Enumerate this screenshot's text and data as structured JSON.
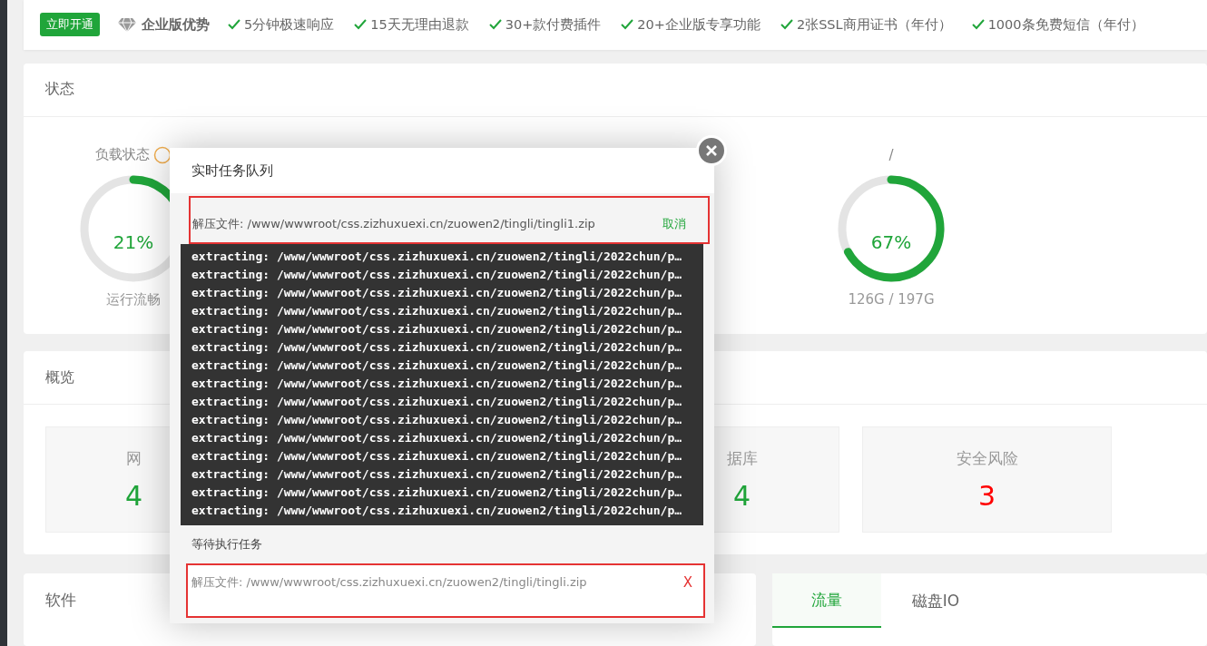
{
  "banner": {
    "button": "立即开通",
    "title": "企业版优势",
    "features": [
      "5分钟极速响应",
      "15天无理由退款",
      "30+款付费插件",
      "20+企业版专享功能",
      "2张SSL商用证书（年付）",
      "1000条免费短信（年付）"
    ]
  },
  "status": {
    "title": "状态",
    "gauges": [
      {
        "kind": "load",
        "label": "负载状态",
        "value": "21%",
        "level": 0.21,
        "caption": "运行流畅"
      },
      {
        "kind": "disk",
        "label": "/",
        "value": "67%",
        "level": 0.67,
        "caption": "126G / 197G"
      }
    ]
  },
  "overview": {
    "title": "概览",
    "cards": [
      {
        "label": "网",
        "value": "4",
        "color": "#20a53a"
      },
      {
        "label": "据库",
        "value": "4",
        "color": "#20a53a"
      },
      {
        "label": "安全风险",
        "value": "3",
        "color": "#ff0000"
      }
    ]
  },
  "software": {
    "title": "软件"
  },
  "traffic": {
    "tabs": [
      {
        "label": "流量",
        "selected": true
      },
      {
        "label": "磁盘IO",
        "selected": false
      }
    ]
  },
  "dialog": {
    "title": "实时任务队列",
    "current_task": {
      "text": "解压文件: /www/wwwroot/css.zizhuxuexi.cn/zuowen2/tingli/tingli1.zip",
      "action": "取消"
    },
    "log": [
      "extracting: /www/wwwroot/css.zizhuxuexi.cn/zuowen2/tingli/2022chun/p…",
      "extracting: /www/wwwroot/css.zizhuxuexi.cn/zuowen2/tingli/2022chun/p…",
      "extracting: /www/wwwroot/css.zizhuxuexi.cn/zuowen2/tingli/2022chun/p…",
      "extracting: /www/wwwroot/css.zizhuxuexi.cn/zuowen2/tingli/2022chun/p…",
      "extracting: /www/wwwroot/css.zizhuxuexi.cn/zuowen2/tingli/2022chun/p…",
      "extracting: /www/wwwroot/css.zizhuxuexi.cn/zuowen2/tingli/2022chun/p…",
      "extracting: /www/wwwroot/css.zizhuxuexi.cn/zuowen2/tingli/2022chun/p…",
      "extracting: /www/wwwroot/css.zizhuxuexi.cn/zuowen2/tingli/2022chun/p…",
      "extracting: /www/wwwroot/css.zizhuxuexi.cn/zuowen2/tingli/2022chun/p…",
      "extracting: /www/wwwroot/css.zizhuxuexi.cn/zuowen2/tingli/2022chun/p…",
      "extracting: /www/wwwroot/css.zizhuxuexi.cn/zuowen2/tingli/2022chun/p…",
      "extracting: /www/wwwroot/css.zizhuxuexi.cn/zuowen2/tingli/2022chun/p…",
      "extracting: /www/wwwroot/css.zizhuxuexi.cn/zuowen2/tingli/2022chun/p…",
      "extracting: /www/wwwroot/css.zizhuxuexi.cn/zuowen2/tingli/2022chun/p…",
      "extracting: /www/wwwroot/css.zizhuxuexi.cn/zuowen2/tingli/2022chun/p…"
    ],
    "waiting_title": "等待执行任务",
    "waiting": [
      {
        "text": "解压文件: /www/wwwroot/css.zizhuxuexi.cn/zuowen2/tingli/tingli.zip",
        "action": "X"
      }
    ]
  }
}
